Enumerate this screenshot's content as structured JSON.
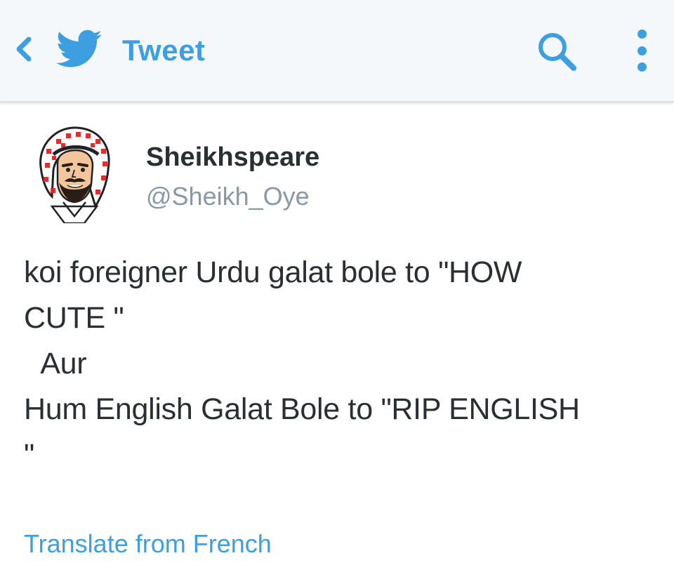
{
  "colors": {
    "accent": "#3d9fe0",
    "topbar_bg": "#f5f8fa",
    "text": "#292f33",
    "muted": "#8899a6"
  },
  "header": {
    "back_icon": "chevron-left-icon",
    "logo_icon": "twitter-bird-icon",
    "title": "Tweet",
    "search_icon": "search-icon",
    "more_icon": "more-vertical-icon"
  },
  "tweet": {
    "author": {
      "display_name": "Sheikhspeare",
      "handle": "@Sheikh_Oye",
      "avatar_icon": "cartoon-sheikh-avatar"
    },
    "text_lines": [
      "koi foreigner Urdu galat bole to \"HOW",
      "CUTE \"",
      "  Aur",
      "Hum English Galat Bole to \"RIP ENGLISH",
      "\""
    ],
    "translate_label": "Translate from French"
  }
}
